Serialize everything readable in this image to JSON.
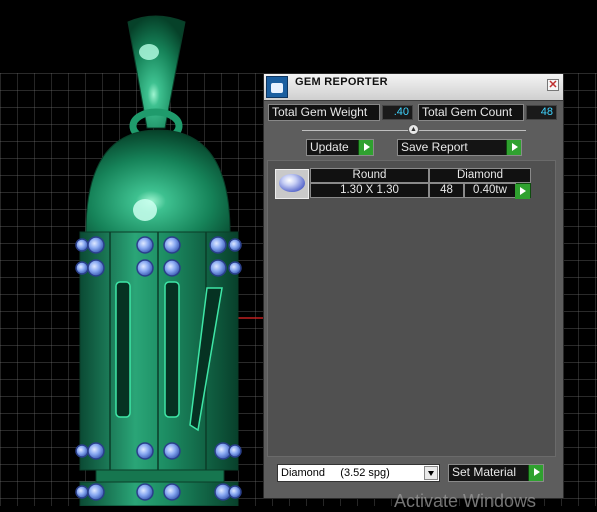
{
  "panel": {
    "title": "GEM REPORTER",
    "close_glyph": "✕",
    "total_weight_label": "Total Gem Weight",
    "total_weight_value": ".40",
    "total_count_label": "Total Gem Count",
    "total_count_value": "48",
    "update_label": "Update",
    "save_report_label": "Save Report",
    "set_material_label": "Set Material",
    "material_selected": "Diamond     (3.52 spg)"
  },
  "gems": [
    {
      "shape": "Round",
      "material": "Diamond",
      "size": "1.30 X 1.30",
      "count": "48",
      "weight": "0.40tw"
    }
  ],
  "watermark": "Activate Windows",
  "colors": {
    "model_green": "#1b8a5e",
    "gem_blue": "#7fa6ef",
    "value_cyan": "#3fd4ff",
    "go_green": "#2fa12f",
    "grid": "#7a7a7a"
  },
  "icons": {
    "app": "gem-reporter-icon",
    "close": "close-icon",
    "go": "play-arrow-icon",
    "dropdown": "chevron-down-icon"
  }
}
